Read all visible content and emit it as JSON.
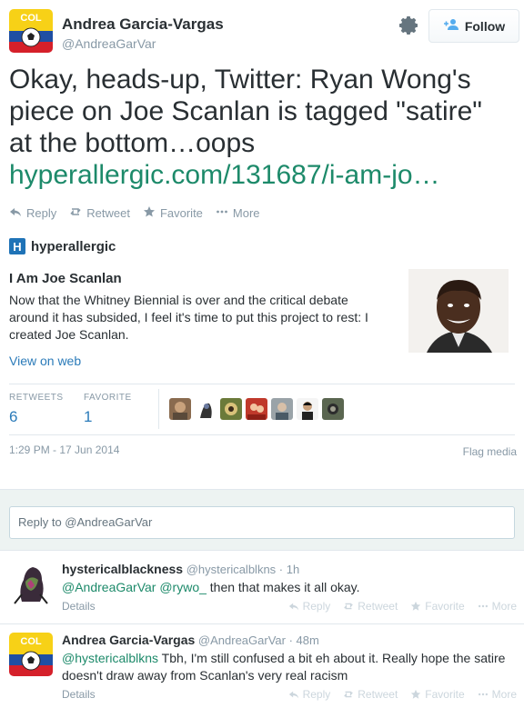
{
  "tweet": {
    "author_name": "Andrea Garcia-Vargas",
    "author_handle": "@AndreaGarVar",
    "follow_label": "Follow",
    "avatar_text": "COL",
    "text_plain": "Okay, heads-up, Twitter: Ryan Wong's piece on Joe Scanlan is tagged \"satire\" at the bottom…oops ",
    "text_link": "hyperallergic.com/131687/i-am-jo…",
    "actions": {
      "reply": "Reply",
      "retweet": "Retweet",
      "favorite": "Favorite",
      "more": "More"
    }
  },
  "card": {
    "source_logo": "H",
    "source": "hyperallergic",
    "title": "I Am Joe Scanlan",
    "description": "Now that the Whitney Biennial is over and the critical debate around it has subsided, I feel it's time to put this project to rest: I created Joe Scanlan.",
    "view_on_web": "View on web"
  },
  "stats": {
    "retweets_label": "RETWEETS",
    "retweets_value": "6",
    "favorite_label": "FAVORITE",
    "favorite_value": "1"
  },
  "timestamp": "1:29 PM - 17 Jun 2014",
  "flag_media": "Flag media",
  "reply_box": {
    "placeholder": "Reply to @AndreaGarVar"
  },
  "replies": [
    {
      "name": "hystericalblackness",
      "meta": "@hystericalblkns · 1h",
      "mentions": "@AndreaGarVar @rywo_",
      "text": " then that makes it all okay.",
      "details": "Details"
    },
    {
      "name": "Andrea Garcia-Vargas",
      "meta": "@AndreaGarVar · 48m",
      "mentions": "@hystericalblkns",
      "text": " Tbh, I'm still confused a bit eh about it. Really hope the satire doesn't draw away from Scanlan's very real racism",
      "details": "Details",
      "avatar_text": "COL"
    }
  ],
  "reply_actions": {
    "reply": "Reply",
    "retweet": "Retweet",
    "favorite": "Favorite",
    "more": "More"
  },
  "colors": {
    "link": "#1d8a6a",
    "blue": "#2b7bb9",
    "muted": "#8899a6"
  }
}
